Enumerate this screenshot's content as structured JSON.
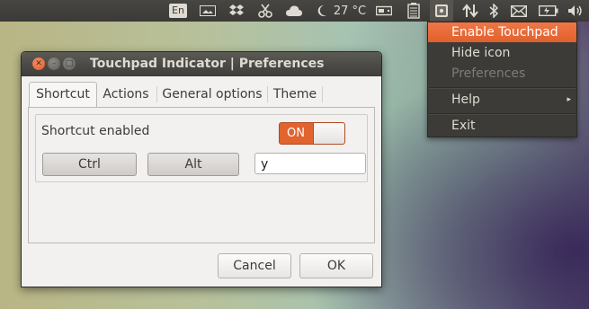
{
  "panel": {
    "keyboard_layout": "En",
    "temperature": "27 °C",
    "icons": [
      "keyboard-layout-icon",
      "screen-icon",
      "dropbox-icon",
      "scissors-icon",
      "cloud-icon",
      "moon-icon",
      "temperature",
      "drive-icon",
      "battery-card-icon",
      "touchpad-indicator-icon",
      "network-transfer-icon",
      "bluetooth-icon",
      "mail-icon",
      "battery-icon",
      "volume-icon"
    ]
  },
  "menu": {
    "items": [
      {
        "label": "Enable Touchpad",
        "state": "highlighted"
      },
      {
        "label": "Hide icon",
        "state": "normal"
      },
      {
        "label": "Preferences",
        "state": "disabled"
      },
      {
        "label": "Help",
        "state": "submenu"
      },
      {
        "label": "Exit",
        "state": "normal"
      }
    ],
    "submenu_arrow": "▸"
  },
  "window": {
    "title": "Touchpad Indicator | Preferences",
    "tabs": [
      "Shortcut",
      "Actions",
      "General options",
      "Theme"
    ],
    "active_tab": "Shortcut",
    "shortcut_enabled_label": "Shortcut enabled",
    "switch_state": "ON",
    "modifier_keys": [
      "Ctrl",
      "Alt"
    ],
    "key_value": "y",
    "cancel_label": "Cancel",
    "ok_label": "OK"
  },
  "colors": {
    "accent": "#e1632d",
    "panel": "#3c3b37",
    "window_bg": "#f2f1f0"
  }
}
